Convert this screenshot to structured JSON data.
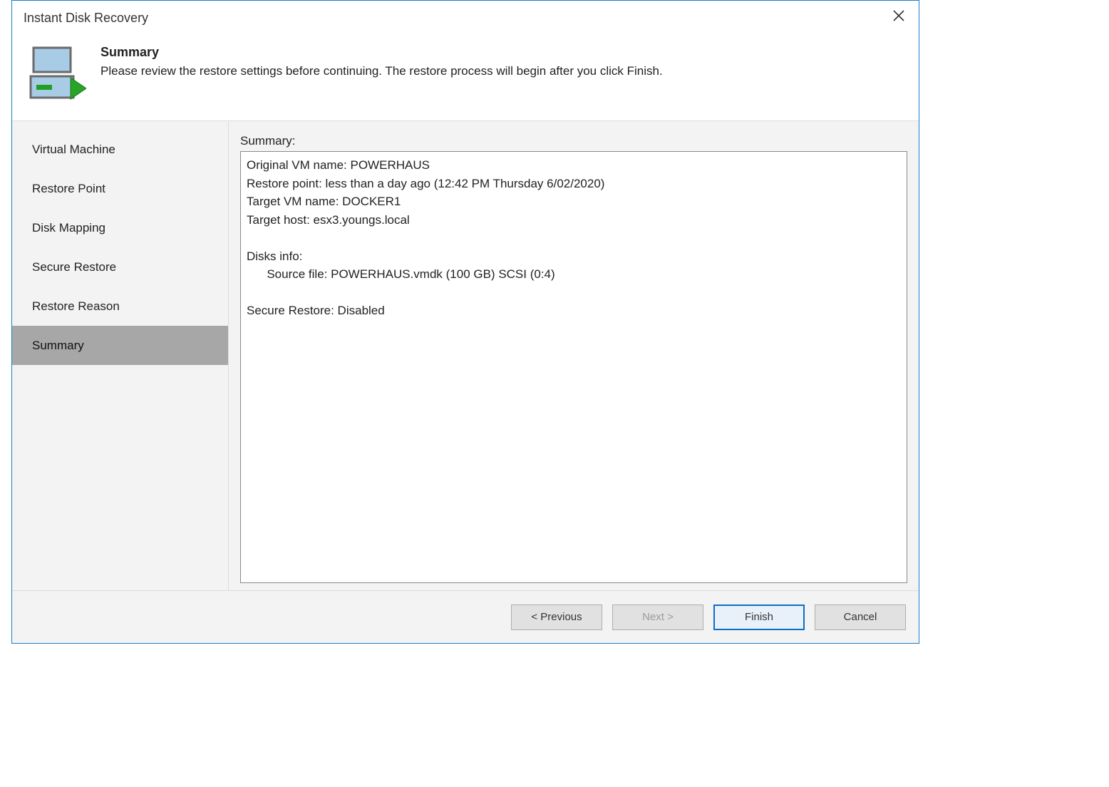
{
  "title": "Instant Disk Recovery",
  "header": {
    "heading": "Summary",
    "subtitle": "Please review the restore settings before continuing. The restore process will begin after you click Finish."
  },
  "sidebar": {
    "items": [
      {
        "label": "Virtual Machine"
      },
      {
        "label": "Restore Point"
      },
      {
        "label": "Disk Mapping"
      },
      {
        "label": "Secure Restore"
      },
      {
        "label": "Restore Reason"
      },
      {
        "label": "Summary",
        "active": true
      }
    ]
  },
  "main": {
    "label": "Summary:",
    "lines": {
      "l1": "Original VM name: POWERHAUS",
      "l2": "Restore point: less than a day ago (12:42 PM Thursday 6/02/2020)",
      "l3": "Target VM name: DOCKER1",
      "l4": "Target host: esx3.youngs.local",
      "l5": "",
      "l6": "Disks info:",
      "l7": "      Source file: POWERHAUS.vmdk (100 GB) SCSI (0:4)",
      "l8": "",
      "l9": "Secure Restore: Disabled"
    }
  },
  "footer": {
    "previous": "< Previous",
    "next": "Next >",
    "finish": "Finish",
    "cancel": "Cancel"
  }
}
